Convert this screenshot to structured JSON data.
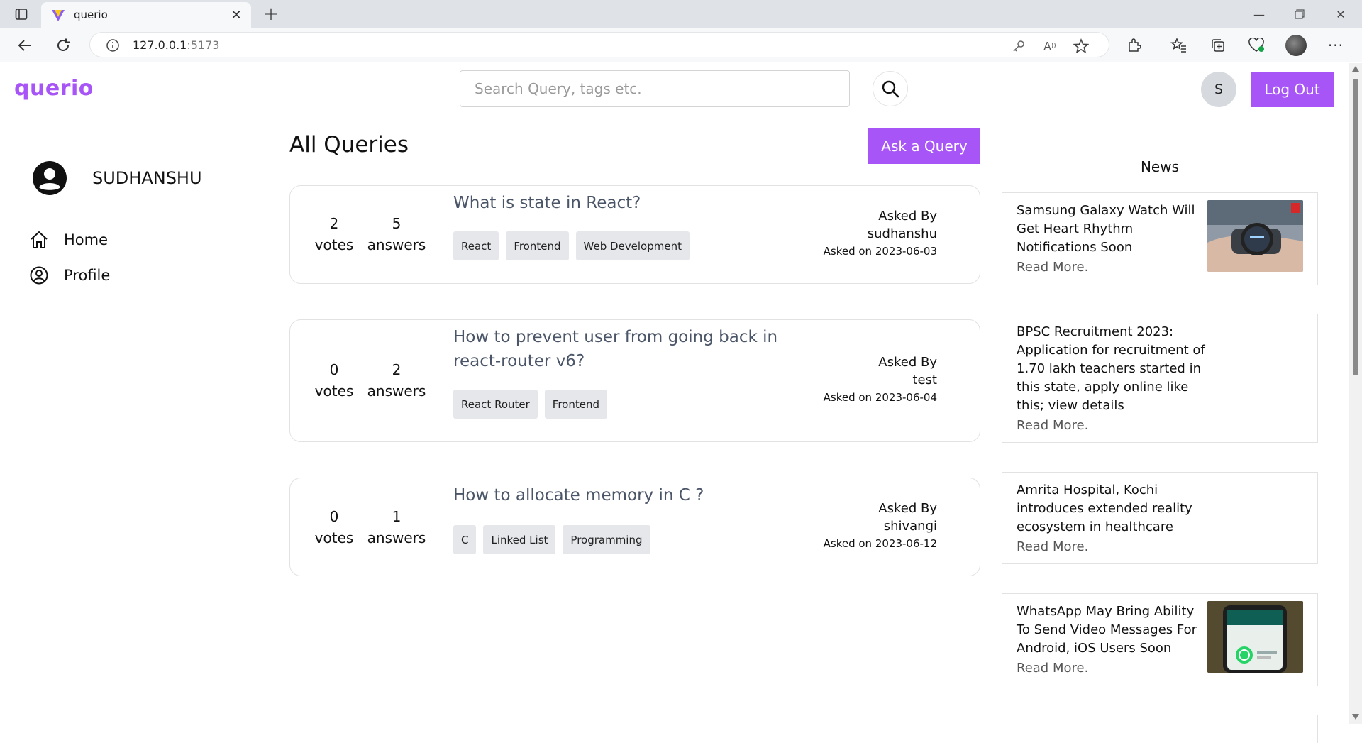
{
  "browser": {
    "tab_title": "querio",
    "url_host": "127.0.0.1",
    "url_port": ":5173"
  },
  "header": {
    "logo": "querio",
    "search_placeholder": "Search Query, tags etc.",
    "avatar_initial": "S",
    "logout_label": "Log Out"
  },
  "sidebar": {
    "username": "SUDHANSHU",
    "items": [
      {
        "label": "Home",
        "icon": "home-icon"
      },
      {
        "label": "Profile",
        "icon": "user-circle-icon"
      }
    ]
  },
  "main": {
    "title": "All Queries",
    "ask_label": "Ask a Query",
    "queries": [
      {
        "votes": "2",
        "votes_label": "votes",
        "answers": "5",
        "answers_label": "answers",
        "title": "What is state in React?",
        "tags": [
          "React",
          "Frontend",
          "Web Development"
        ],
        "asked_by_label": "Asked By",
        "author": "sudhanshu",
        "asked_on": "Asked on 2023-06-03"
      },
      {
        "votes": "0",
        "votes_label": "votes",
        "answers": "2",
        "answers_label": "answers",
        "title": "How to prevent user from going back in react-router v6?",
        "tags": [
          "React Router",
          "Frontend"
        ],
        "asked_by_label": "Asked By",
        "author": "test",
        "asked_on": "Asked on 2023-06-04"
      },
      {
        "votes": "0",
        "votes_label": "votes",
        "answers": "1",
        "answers_label": "answers",
        "title": "How to allocate memory in C ?",
        "tags": [
          "C",
          "Linked List",
          "Programming"
        ],
        "asked_by_label": "Asked By",
        "author": "shivangi",
        "asked_on": "Asked on 2023-06-12"
      }
    ]
  },
  "news": {
    "title": "News",
    "read_more": "Read More.",
    "items": [
      {
        "headline": "Samsung Galaxy Watch Will Get Heart Rhythm Notifications Soon",
        "has_image": true,
        "image": "smartwatch-image"
      },
      {
        "headline": "BPSC Recruitment 2023: Application for recruitment of 1.70 lakh teachers started in this state, apply online like this; view details",
        "has_image": false
      },
      {
        "headline": "Amrita Hospital, Kochi introduces extended reality ecosystem in healthcare",
        "has_image": false
      },
      {
        "headline": "WhatsApp May Bring Ability To Send Video Messages For Android, iOS Users Soon",
        "has_image": true,
        "image": "whatsapp-phone-image"
      }
    ]
  },
  "colors": {
    "accent": "#a855f7",
    "tag_bg": "#e5e7eb",
    "question_title": "#4a5568"
  }
}
